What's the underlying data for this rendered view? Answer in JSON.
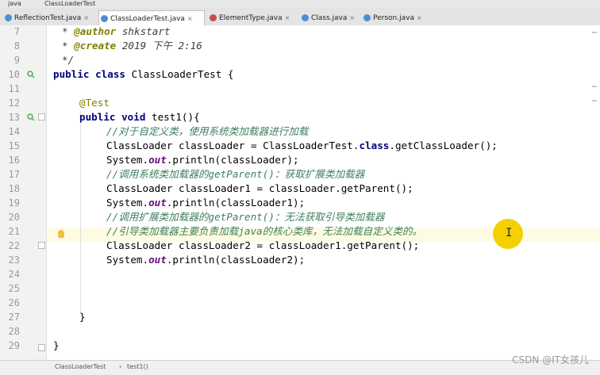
{
  "breadcrumb": [
    "java",
    "ClassLoaderTest"
  ],
  "tabs": [
    {
      "label": "ReflectionTest.java",
      "icon": "java-class-icon",
      "color": "#4a8fd6",
      "active": false
    },
    {
      "label": "ClassLoaderTest.java",
      "icon": "java-class-icon",
      "color": "#4a8fd6",
      "active": true
    },
    {
      "label": "ElementType.java",
      "icon": "enum-icon",
      "color": "#c05050",
      "active": false
    },
    {
      "label": "Class.java",
      "icon": "java-class-icon",
      "color": "#4a8fd6",
      "active": false
    },
    {
      "label": "Person.java",
      "icon": "java-class-icon",
      "color": "#4a8fd6",
      "active": false
    }
  ],
  "tab_close_glyph": "×",
  "line_numbers": [
    "7",
    "8",
    "9",
    "10",
    "11",
    "12",
    "13",
    "14",
    "15",
    "16",
    "17",
    "18",
    "19",
    "20",
    "21",
    "22",
    "23",
    "24",
    "25",
    "26",
    "27",
    "28",
    "29"
  ],
  "code": {
    "l7": [
      "* ",
      "@author",
      " shkstart"
    ],
    "l8": [
      "* ",
      "@create",
      " 2019 下午 2:16"
    ],
    "l9": "*/",
    "l10": [
      "public class",
      " ClassLoaderTest {"
    ],
    "l12": "@Test",
    "l13": [
      "public void",
      " test1(){"
    ],
    "l14": "//对于自定义类，使用系统类加载器进行加载",
    "l15": [
      "ClassLoader classLoader = ClassLoaderTest.",
      "class",
      ".getClassLoader();"
    ],
    "l16": [
      "System.",
      "out",
      ".println(classLoader);"
    ],
    "l17": "//调用系统类加载器的getParent()：获取扩展类加载器",
    "l18": "ClassLoader classLoader1 = classLoader.getParent();",
    "l19": [
      "System.",
      "out",
      ".println(classLoader1);"
    ],
    "l20": "//调用扩展类加载器的getParent()：无法获取引导类加载器",
    "l21": "//引导类加载器主要负责加载java的核心类库，无法加载自定义类的。",
    "l22": "ClassLoader classLoader2 = classLoader1.getParent();",
    "l23": [
      "System.",
      "out",
      ".println(classLoader2);"
    ],
    "l27": "}",
    "l29": "}"
  },
  "status": {
    "class_crumb": "ClassLoaderTest",
    "separator": "›",
    "method_crumb": "test1()"
  },
  "watermark": "CSDN @IT女孩儿",
  "cursor_glyph": "I",
  "colors": {
    "keyword": "#000080",
    "comment": "#3f7f5f",
    "annotation": "#808000",
    "static_field": "#660e7a",
    "highlight_line": "#fefbe4",
    "cursor_highlight": "#f5d000"
  }
}
